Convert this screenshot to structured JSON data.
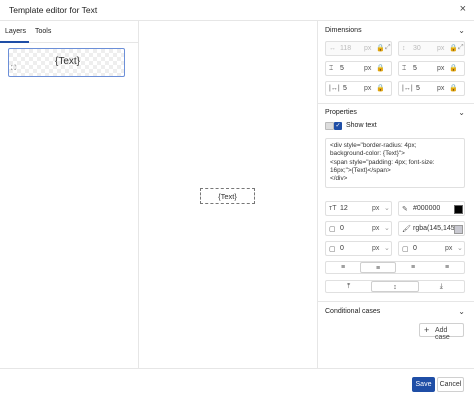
{
  "window": {
    "title": "Template editor for Text",
    "close_icon": "×"
  },
  "left": {
    "tabs": [
      "Layers",
      "Tools"
    ],
    "layer_label": "{Text}",
    "layer_handle_icon": "⛶"
  },
  "canvas": {
    "item_label": "{Text}"
  },
  "dimensions": {
    "heading": "Dimensions",
    "width": "118",
    "width_unit": "px",
    "height": "30",
    "height_unit": "px",
    "margin_top": "5",
    "margin_top_unit": "px",
    "margin_bottom": "5",
    "margin_bottom_unit": "px",
    "margin_left": "5",
    "margin_left_unit": "px",
    "margin_right": "5",
    "margin_right_unit": "px"
  },
  "properties": {
    "heading": "Properties",
    "show_text_label": "Show text",
    "show_text_checked": true,
    "code": "<div style=\"border-radius: 4px;\nbackground-color: {Text}\">\n<span style=\"padding: 4px; font-size:\n16px;\">{Text}</span>\n</div>",
    "font_size": "12",
    "font_size_unit": "px",
    "text_color": "#000000",
    "border_width": "0",
    "border_width_unit": "px",
    "fill_color": "rgba(145,145,",
    "radius": "0",
    "radius_unit": "px",
    "padding": "0",
    "padding_unit": "px"
  },
  "conditional": {
    "heading": "Conditional cases",
    "add_case_label": "Add case"
  },
  "footer": {
    "save_label": "Save",
    "cancel_label": "Cancel"
  },
  "colors": {
    "accent": "#1f4ea6",
    "text_color_swatch": "#000000"
  }
}
